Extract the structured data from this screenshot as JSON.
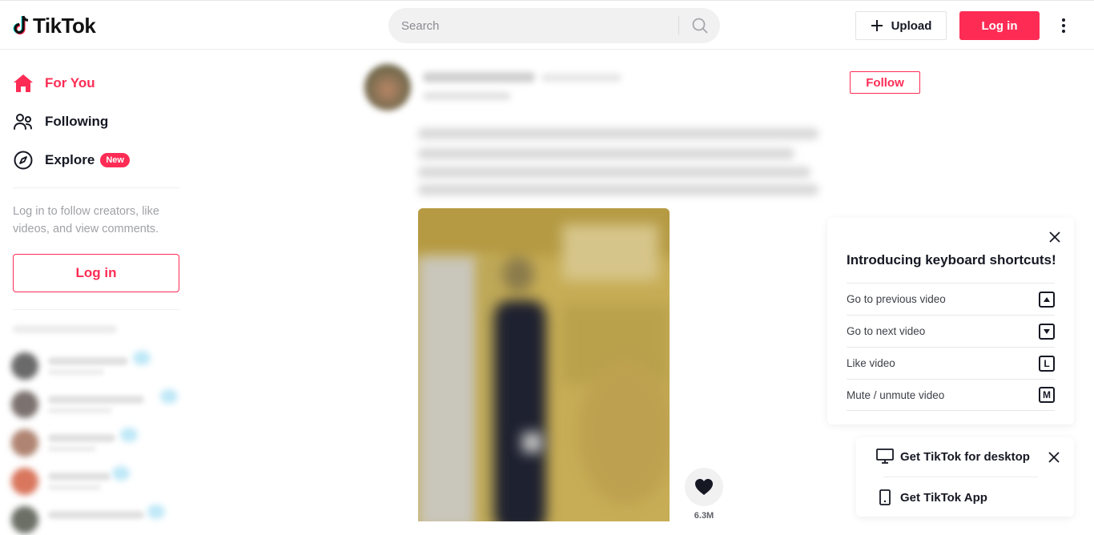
{
  "header": {
    "logo_text": "TikTok",
    "search": {
      "placeholder": "Search",
      "value": ""
    },
    "upload_label": "Upload",
    "login_label": "Log in",
    "icons": {
      "search": "search-icon",
      "upload": "plus-icon",
      "more": "more-vertical-icon"
    }
  },
  "sidebar": {
    "nav": [
      {
        "label": "For You",
        "icon": "home-icon",
        "active": true
      },
      {
        "label": "Following",
        "icon": "users-icon",
        "active": false
      },
      {
        "label": "Explore",
        "icon": "compass-icon",
        "active": false,
        "badge": "New"
      }
    ],
    "login_hint": "Log in to follow creators, like videos, and view comments.",
    "login_button": "Log in",
    "suggested_accounts_blurred": true
  },
  "post": {
    "author_blurred": true,
    "caption_blurred": true,
    "follow_label": "Follow",
    "like_count": "6.3M"
  },
  "shortcuts_panel": {
    "title": "Introducing keyboard shortcuts!",
    "rows": [
      {
        "label": "Go to previous video",
        "key": "▲"
      },
      {
        "label": "Go to next video",
        "key": "▼"
      },
      {
        "label": "Like video",
        "key": "L"
      },
      {
        "label": "Mute / unmute video",
        "key": "M"
      }
    ]
  },
  "get_app_panel": {
    "desktop_label": "Get TikTok for desktop",
    "app_label": "Get TikTok App"
  },
  "colors": {
    "brand": "#fe2c55",
    "text": "#161823",
    "muted": "#a1a2a7"
  }
}
